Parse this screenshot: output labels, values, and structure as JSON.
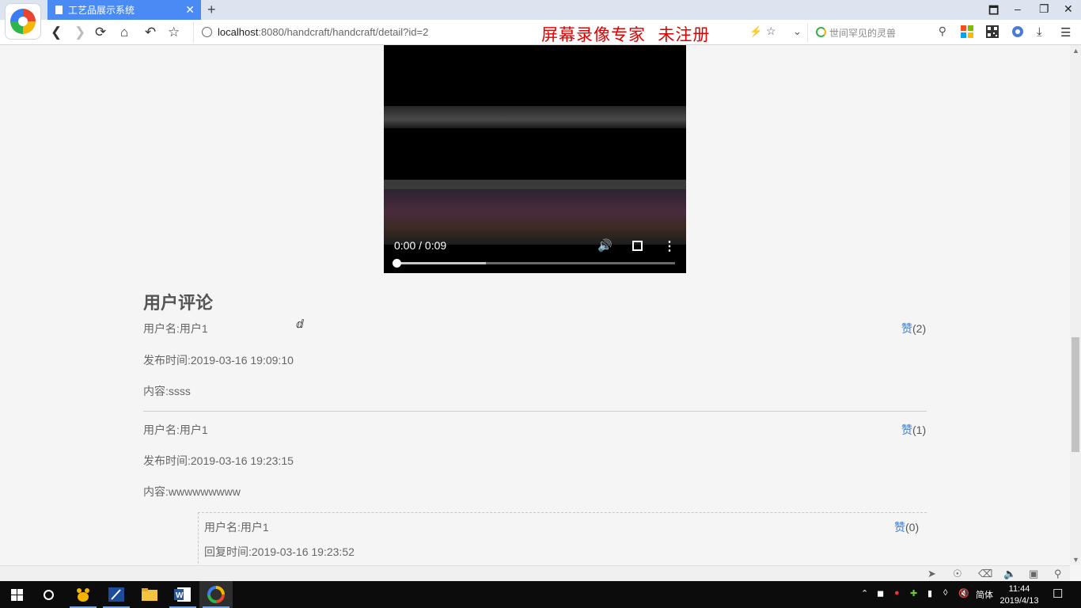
{
  "browser": {
    "tab_title": "工艺品展示系统",
    "tab_close": "✕",
    "new_tab": "+",
    "url_host": "localhost",
    "url_rest": ":8080/handcraft/handcraft/detail?id=2",
    "watermark": "屏幕录像专家  未注册",
    "search_placeholder": "世间罕见的灵兽",
    "window_controls": [
      "🗖",
      "–",
      "❐",
      "✕"
    ]
  },
  "video": {
    "time": "0:00 / 0:09",
    "progress": 0.0,
    "buffered": 0.32
  },
  "comments": {
    "section_title": "用户评论",
    "items": [
      {
        "user_label": "用户名:用户1",
        "time_label": "发布时间:2019-03-16 19:09:10",
        "content_label": "内容:ssss",
        "like_word": "赞",
        "like_count": "(2)"
      },
      {
        "user_label": "用户名:用户1",
        "time_label": "发布时间:2019-03-16 19:23:15",
        "content_label": "内容:wwwwwwwww",
        "like_word": "赞",
        "like_count": "(1)"
      }
    ],
    "reply": {
      "user_label": "用户名:用户1",
      "time_label": "回复时间:2019-03-16 19:23:52",
      "like_word": "赞",
      "like_count": "(0)"
    }
  },
  "taskbar": {
    "ime": "简体",
    "time": "11:44",
    "date": "2019/4/13"
  }
}
